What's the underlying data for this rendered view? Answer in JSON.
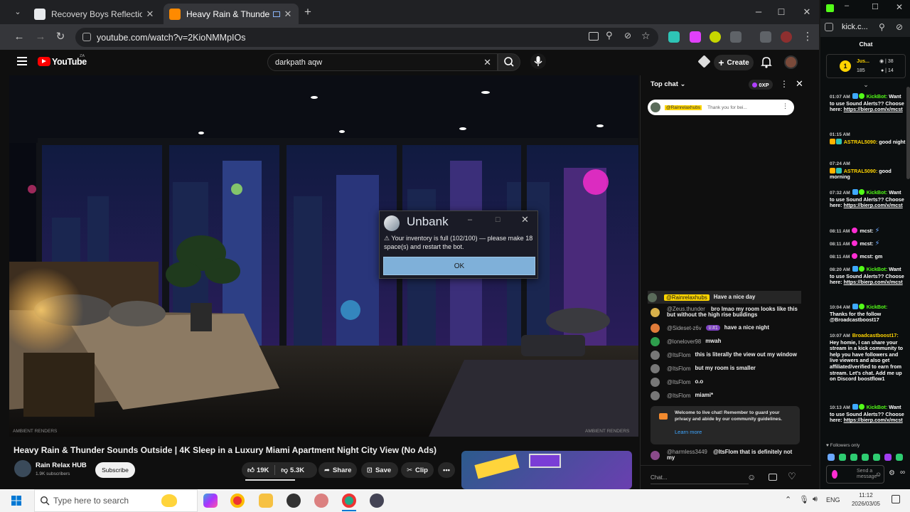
{
  "browser": {
    "tabs": [
      {
        "title": "Recovery Boys Reflection",
        "active": false
      },
      {
        "title": "Heavy Rain & Thunder Sou",
        "active": true
      }
    ],
    "url": "youtube.com/watch?v=2KioNMMpIOs"
  },
  "youtube": {
    "logo_text": "YouTube",
    "country": "ZA",
    "search_value": "darkpath aqw",
    "create_label": "Create",
    "watermark_left": "AMBIENT RENDERS",
    "watermark_right": "AMBIENT RENDERS",
    "video_title": "Heavy Rain & Thunder Sounds Outside | 4K Sleep in a Luxury Miami Apartment Night City View (No Ads)",
    "channel_name": "Rain Relax HUB",
    "subscribers": "1.9K subscribers",
    "subscribe_label": "Subscribe",
    "likes": "19K",
    "dislikes": "5.3K",
    "share_label": "Share",
    "save_label": "Save",
    "clip_label": "Clip"
  },
  "yt_chat": {
    "header": "Top chat",
    "points": "0XP",
    "pinned_author": "@Rainrelaxhubs",
    "pinned_text": "Thank you for bei...",
    "messages": [
      {
        "author": "@Rainrelaxhubs",
        "text": "Have a nice day",
        "owner": true
      },
      {
        "author": "@Zeus.thunder",
        "text": "bro lmao my room looks like this but without the high rise buildings"
      },
      {
        "author": "@Sideset-z6v",
        "text": "have a nice night",
        "badge": "#1"
      },
      {
        "author": "@lonelover98",
        "text": "mwah"
      },
      {
        "author": "@ItsFlom",
        "text": "this is literally the view out my window"
      },
      {
        "author": "@ItsFlom",
        "text": "but my room is smaller"
      },
      {
        "author": "@ItsFlom",
        "text": "o.o"
      },
      {
        "author": "@ItsFlom",
        "text": "miami*"
      }
    ],
    "welcome_text": "Welcome to live chat! Remember to guard your privacy and abide by our community guidelines.",
    "learn_more": "Learn more",
    "last_author": "@harmless3449",
    "last_text": "@ItsFlom that is definitely not my",
    "input_placeholder": "Chat..."
  },
  "dialog": {
    "title": "Unbank",
    "message": "Your inventory is full (102/100) — please make 18 space(s) and restart the bot.",
    "ok_label": "OK"
  },
  "kick": {
    "url": "kick.c...",
    "chat_title": "Chat",
    "top_user": "Jus...",
    "stat1": "38",
    "stat2": "185",
    "stat3": "14",
    "lines": [
      {
        "time": "01:07 AM",
        "user": "KickBot:",
        "text": "Want to use Sound Alerts?? Choose here:",
        "link": "https://bierp.com/x/mcst",
        "green": true
      },
      {
        "time": "01:15 AM",
        "user": "ASTRAL5090:",
        "text": "good night"
      },
      {
        "time": "07:24 AM",
        "user": "ASTRAL5090:",
        "text": "good morning"
      },
      {
        "time": "07:32 AM",
        "user": "KickBot:",
        "text": "Want to use Sound Alerts?? Choose here:",
        "link": "https://bierp.com/x/mcst",
        "green": true
      },
      {
        "time": "08:11 AM",
        "user": "mcst:",
        "text": ""
      },
      {
        "time": "08:11 AM",
        "user": "mcst:",
        "text": ""
      },
      {
        "time": "08:11 AM",
        "user": "mcst:",
        "text": "gm"
      },
      {
        "time": "08:20 AM",
        "user": "KickBot:",
        "text": "Want to use Sound Alerts?? Choose here:",
        "link": "https://bierp.com/x/mcst",
        "green": true
      },
      {
        "time": "10:04 AM",
        "user": "KickBot:",
        "text": "Thanks for the follow @Broadcastboost17",
        "green": true
      },
      {
        "time": "10:07 AM",
        "user": "Broadcastboost17:",
        "text": "Hey homie, I can share your stream in a kick community to help you have followers and live viewers and also get affiliated/verified to earn from stream. Let's chat. Add me up on Discord boostflow1"
      },
      {
        "time": "10:13 AM",
        "user": "KickBot:",
        "text": "Want to use Sound Alerts?? Choose here:",
        "link": "https://bierp.com/x/mcst",
        "green": true
      }
    ],
    "followers_only": "Followers only",
    "send_placeholder": "Send a message"
  },
  "taskbar": {
    "search_placeholder": "Type here to search",
    "lang": "ENG",
    "time": "11:12",
    "date": "2026/03/05"
  }
}
